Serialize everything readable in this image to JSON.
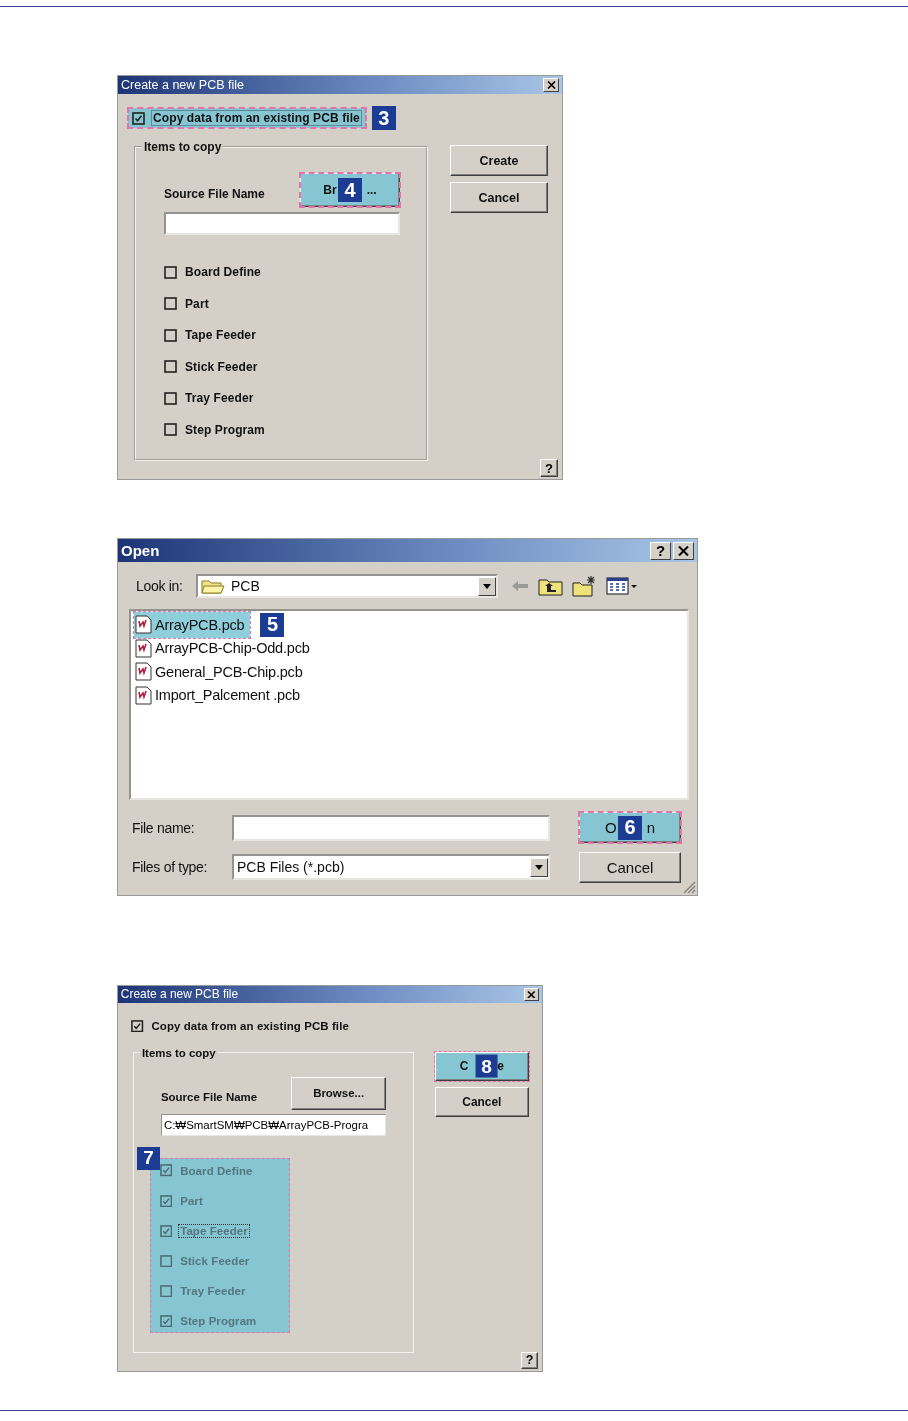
{
  "dialogs": [
    {
      "kind": "create",
      "title": "Create a new PCB file",
      "copy_option": {
        "label": "Copy data from an existing PCB file",
        "checked": true,
        "focused": true,
        "step": "3"
      },
      "group_label": "Items to copy",
      "source_label": "Source File Name",
      "browse": {
        "label_start": "Br",
        "label_end": "...",
        "step": "4"
      },
      "items": [
        {
          "label": "Board Define",
          "checked": false,
          "focused": false
        },
        {
          "label": "Part",
          "checked": false,
          "focused": false
        },
        {
          "label": "Tape Feeder",
          "checked": false,
          "focused": false
        },
        {
          "label": "Stick Feeder",
          "checked": false,
          "focused": false
        },
        {
          "label": "Tray Feeder",
          "checked": false,
          "focused": false
        },
        {
          "label": "Step Program",
          "checked": false,
          "focused": false
        }
      ],
      "buttons": [
        {
          "label": "Create"
        },
        {
          "label": "Cancel"
        }
      ],
      "help": "?"
    },
    {
      "kind": "open",
      "title": "Open",
      "help": "?",
      "look_in_label": "Look in:",
      "look_in_value": "PCB",
      "files": [
        {
          "name": "ArrayPCB.pcb",
          "selected": true,
          "step": "5"
        },
        {
          "name": "ArrayPCB-Chip-Odd.pcb",
          "selected": false
        },
        {
          "name": "General_PCB-Chip.pcb",
          "selected": false
        },
        {
          "name": "Import_Palcement .pcb",
          "selected": false
        }
      ],
      "file_name_label": "File name:",
      "file_type_label": "Files of type:",
      "file_type_value": "PCB Files (*.pcb)",
      "buttons": [
        {
          "label_start": "O",
          "label_end": "n",
          "step": "6"
        },
        {
          "label": "Cancel"
        }
      ]
    },
    {
      "kind": "create",
      "title": "Create a new PCB file",
      "copy_option": {
        "label": "Copy data from an existing PCB file",
        "checked": true,
        "focused": false
      },
      "group_label": "Items to copy",
      "source_label": "Source File Name",
      "browse": {
        "label": "Browse..."
      },
      "source_value": "C:₩SmartSM₩PCB₩ArrayPCB-Progra",
      "items_step": "7",
      "items": [
        {
          "label": "Board Define",
          "checked": true,
          "focused": false
        },
        {
          "label": "Part",
          "checked": true,
          "focused": false
        },
        {
          "label": "Tape Feeder",
          "checked": true,
          "focused": true
        },
        {
          "label": "Stick Feeder",
          "checked": false,
          "focused": false
        },
        {
          "label": "Tray Feeder",
          "checked": false,
          "focused": false
        },
        {
          "label": "Step Program",
          "checked": true,
          "focused": false
        }
      ],
      "buttons": [
        {
          "label_start": "C",
          "label_end": "e",
          "step": "8"
        },
        {
          "label": "Cancel"
        }
      ],
      "help": "?"
    }
  ]
}
